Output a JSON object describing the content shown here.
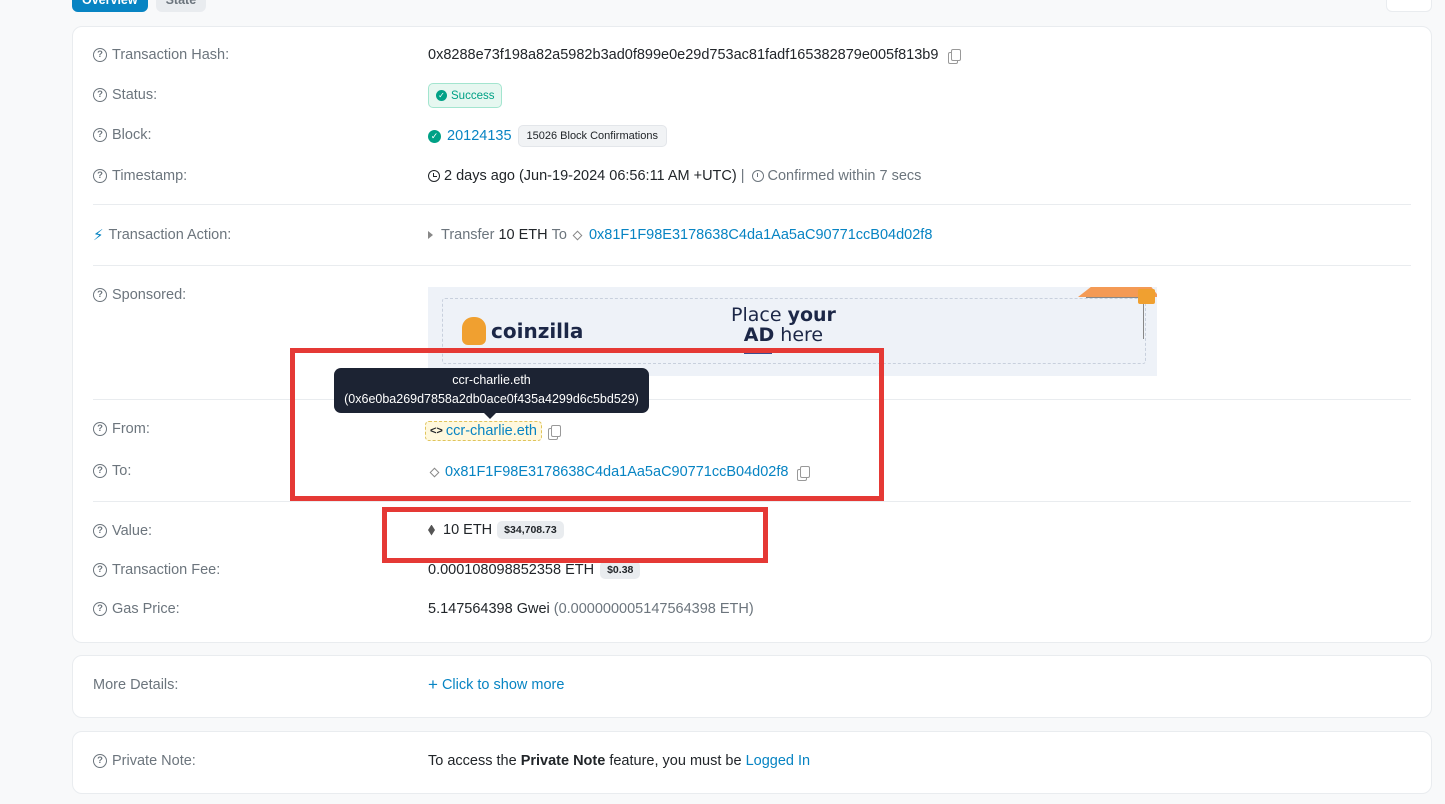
{
  "tabs": [
    {
      "label": "Overview"
    },
    {
      "label": "State"
    }
  ],
  "fields": {
    "tx_hash": {
      "label": "Transaction Hash:",
      "value": "0x8288e73f198a82a5982b3ad0f899e0e29d753ac81fadf165382879e005f813b9"
    },
    "status": {
      "label": "Status:",
      "value": "Success"
    },
    "block": {
      "label": "Block:",
      "value": "20124135",
      "confirmations": "15026 Block Confirmations"
    },
    "timestamp": {
      "label": "Timestamp:",
      "value": "2 days ago (Jun-19-2024 06:56:11 AM +UTC)",
      "separator": "|",
      "confirmed": "Confirmed within 7 secs"
    },
    "action": {
      "label": "Transaction Action:",
      "verb": "Transfer",
      "amount": "10 ETH",
      "to_word": "To",
      "to_address": "0x81F1F98E3178638C4da1Aa5aC90771ccB04d02f8"
    },
    "sponsored": {
      "label": "Sponsored:"
    },
    "from": {
      "label": "From:",
      "value": "ccr-charlie.eth"
    },
    "to": {
      "label": "To:",
      "value": "0x81F1F98E3178638C4da1Aa5aC90771ccB04d02f8"
    },
    "value": {
      "label": "Value:",
      "value": "10 ETH",
      "usd": "$34,708.73"
    },
    "fee": {
      "label": "Transaction Fee:",
      "value": "0.000108098852358 ETH",
      "usd": "$0.38"
    },
    "gas": {
      "label": "Gas Price:",
      "value": "5.147564398 Gwei",
      "eth": "(0.000000005147564398 ETH)"
    }
  },
  "ad": {
    "brand": "coinzilla",
    "line1_a": "Place ",
    "line1_b": "your",
    "line2_a": "AD",
    "line2_b": " here"
  },
  "tooltip": {
    "line1": "ccr-charlie.eth",
    "line2": "(0x6e0ba269d7858a2db0ace0f435a4299d6c5bd529)"
  },
  "more": {
    "label": "More Details:",
    "link": "Click to show more"
  },
  "note": {
    "label": "Private Note:",
    "text_a": "To access the ",
    "text_bold": "Private Note",
    "text_b": " feature, you must be ",
    "link": "Logged In"
  },
  "icons": {
    "question": "?",
    "plus": "+",
    "check": "✓",
    "bolt": "⚡"
  },
  "colors": {
    "accent": "#0784c3",
    "success": "#00a186",
    "highlight_box": "#e53935"
  }
}
